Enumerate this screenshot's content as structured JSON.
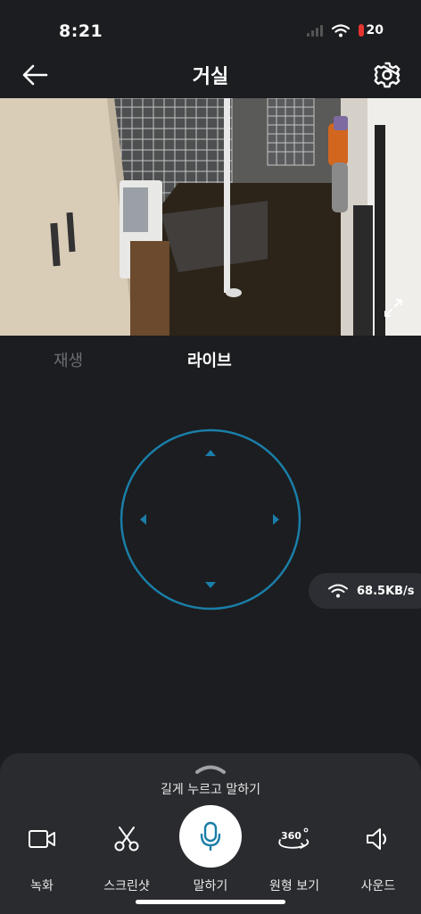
{
  "status": {
    "time": "8:21",
    "battery": "20"
  },
  "nav": {
    "title": "거실"
  },
  "tabs": {
    "playback": "재생",
    "live": "라이브"
  },
  "network": {
    "speed": "68.5KB/s"
  },
  "sheet": {
    "hint": "길게 누르고 말하기"
  },
  "actions": [
    {
      "label": "녹화",
      "icon": "video-camera-icon"
    },
    {
      "label": "스크린샷",
      "icon": "scissors-icon"
    },
    {
      "label": "말하기",
      "icon": "microphone-icon"
    },
    {
      "label": "원형 보기",
      "icon": "360-view-icon"
    },
    {
      "label": "사운드",
      "icon": "speaker-icon"
    }
  ],
  "colors": {
    "accent": "#1a7ea8",
    "background": "#1c1d20",
    "sheet": "#2a2b2f"
  }
}
